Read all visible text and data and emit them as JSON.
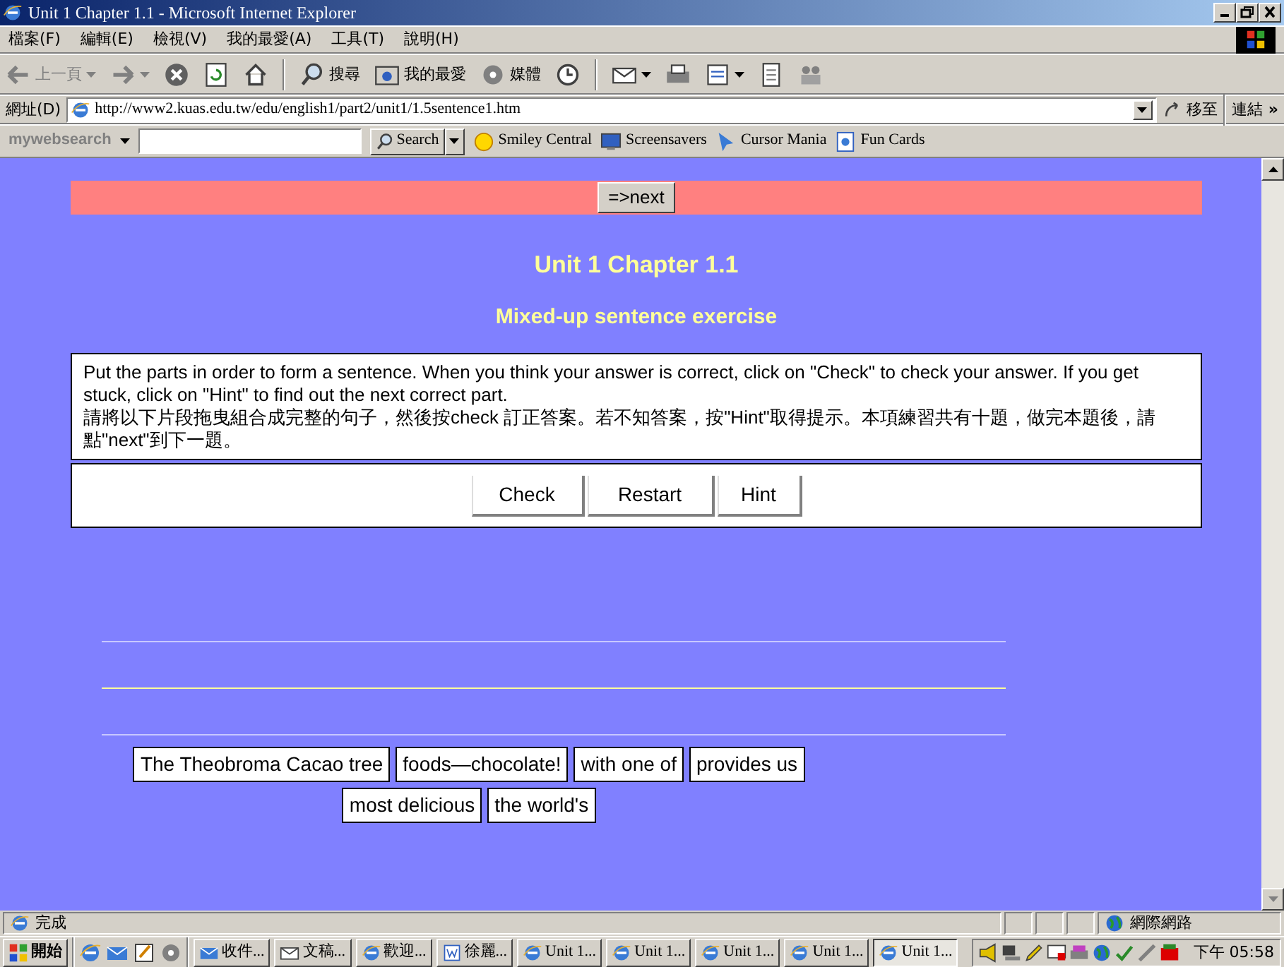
{
  "window": {
    "title": "Unit 1 Chapter 1.1 - Microsoft Internet Explorer"
  },
  "menu": [
    "檔案(F)",
    "編輯(E)",
    "檢視(V)",
    "我的最愛(A)",
    "工具(T)",
    "說明(H)"
  ],
  "toolbar": [
    {
      "kind": "back",
      "label": "上一頁",
      "dropdown": true,
      "disabled": true
    },
    {
      "kind": "forward",
      "dropdown": true,
      "disabled": true
    },
    {
      "kind": "stop"
    },
    {
      "kind": "refresh"
    },
    {
      "kind": "home"
    },
    {
      "kind": "sep"
    },
    {
      "kind": "search",
      "label": "搜尋"
    },
    {
      "kind": "favorites",
      "label": "我的最愛"
    },
    {
      "kind": "media",
      "label": "媒體"
    },
    {
      "kind": "history"
    },
    {
      "kind": "sep"
    },
    {
      "kind": "mail",
      "dropdown": true
    },
    {
      "kind": "print"
    },
    {
      "kind": "edit",
      "dropdown": true
    },
    {
      "kind": "discuss"
    },
    {
      "kind": "messenger"
    }
  ],
  "address": {
    "label": "網址(D)",
    "url": "http://www2.kuas.edu.tw/edu/english1/part2/unit1/1.5sentence1.htm",
    "go": "移至",
    "links": "連結",
    "more": "»"
  },
  "websearch": {
    "brand": "my**web**search",
    "button": "Search",
    "links": [
      {
        "kind": "smiley",
        "label": "Smiley Central"
      },
      {
        "kind": "screen",
        "label": "Screensavers"
      },
      {
        "kind": "cursor",
        "label": "Cursor Mania"
      },
      {
        "kind": "card",
        "label": "Fun Cards"
      }
    ]
  },
  "page": {
    "next_button": "=>next",
    "title": "Unit 1 Chapter 1.1",
    "subtitle": "Mixed-up sentence exercise",
    "instructions": [
      "Put the parts in order to form a sentence. When you think your answer is correct, click on \"Check\" to check your answer. If you get stuck, click on \"Hint\" to find out the next correct part.",
      "請將以下片段拖曳組合成完整的句子，然後按check 訂正答案。若不知答案，按\"Hint\"取得提示。本項練習共有十題，做完本題後，請點\"next\"到下一題。"
    ],
    "buttons": [
      "Check",
      "Restart",
      "Hint"
    ],
    "parts": [
      [
        "The Theobroma Cacao tree",
        "foods—chocolate!",
        "with one of",
        "provides us"
      ],
      [
        "most delicious",
        "the world's"
      ]
    ]
  },
  "status_bar": {
    "text": "完成",
    "zone": "網際網路"
  },
  "taskbar": {
    "start": "開始",
    "tasks": [
      {
        "kind": "outlook",
        "label": "收件...",
        "selected": false
      },
      {
        "kind": "mail",
        "label": "文稿...",
        "selected": false
      },
      {
        "kind": "ie",
        "label": "歡迎...",
        "selected": false
      },
      {
        "kind": "word",
        "label": "徐麗...",
        "selected": false
      },
      {
        "kind": "ie",
        "label": "Unit 1...",
        "selected": false
      },
      {
        "kind": "ie",
        "label": "Unit 1...",
        "selected": false
      },
      {
        "kind": "ie",
        "label": "Unit 1...",
        "selected": false
      },
      {
        "kind": "ie",
        "label": "Unit 1...",
        "selected": false
      },
      {
        "kind": "ie",
        "label": "Unit 1...",
        "selected": true
      }
    ],
    "clock": "下午 05:58"
  }
}
